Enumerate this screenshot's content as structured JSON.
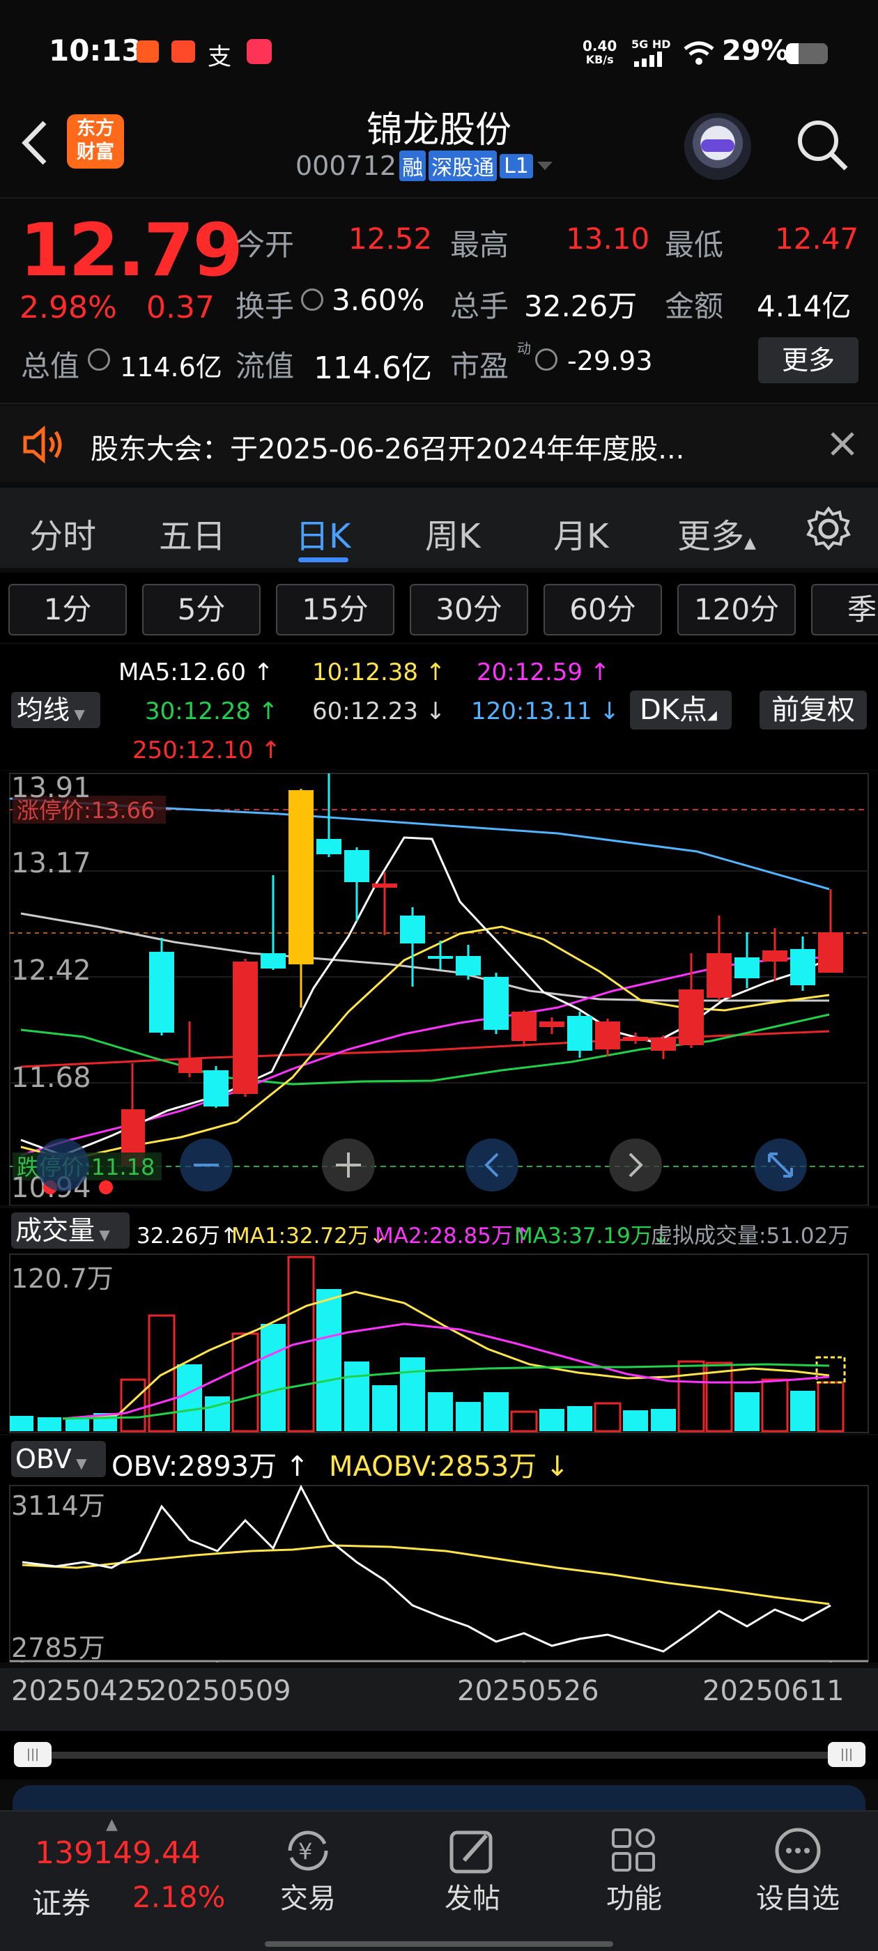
{
  "status_bar": {
    "time": "10:13",
    "net_speed_top": "0.40",
    "net_speed_bottom": "KB/s",
    "signal_label": "5G HD",
    "battery": "29%"
  },
  "header": {
    "brand_line1": "东方",
    "brand_line2": "财富",
    "title": "锦龙股份",
    "code": "000712",
    "tag_rong": "融",
    "tag_sgt": "深股通",
    "tag_l1": "L1"
  },
  "quote": {
    "price": "12.79",
    "change_pct": "2.98%",
    "change": "0.37",
    "open_label": "今开",
    "open": "12.52",
    "high_label": "最高",
    "high": "13.10",
    "low_label": "最低",
    "low": "12.47",
    "turnover_label": "换手",
    "turnover": "3.60%",
    "volume_label": "总手",
    "volume": "32.26万",
    "amount_label": "金额",
    "amount": "4.14亿",
    "mcap_label": "总值",
    "mcap": "114.6亿",
    "float_label": "流值",
    "float_value": "114.6亿",
    "pe_label": "市盈",
    "pe_sup": "动",
    "pe": "-29.93",
    "more_button": "更多"
  },
  "notice": {
    "text": "股东大会：于2025-06-26召开2024年年度股..."
  },
  "period_tabs": [
    "分时",
    "五日",
    "日K",
    "周K",
    "月K",
    "更多"
  ],
  "active_period": "日K",
  "minute_tabs": [
    "1分",
    "5分",
    "15分",
    "30分",
    "60分",
    "120分",
    "季"
  ],
  "ma_panel": {
    "selector": "均线",
    "ma5": "MA5:12.60 ↑",
    "ma10": "10:12.38 ↑",
    "ma20": "20:12.59 ↑",
    "ma30": "30:12.28 ↑",
    "ma60": "60:12.23 ↓",
    "ma120": "120:13.11 ↓",
    "ma250": "250:12.10 ↑",
    "dk_button": "DK点",
    "adjust_button": "前复权"
  },
  "kline": {
    "y_labels": [
      "13.91",
      "13.17",
      "12.42",
      "11.68",
      "10.94"
    ],
    "limit_up": "涨停价:13.66",
    "limit_down": "跌停价:11.18",
    "colors": {
      "up": "#e8262a",
      "down": "#19f3f3",
      "ma5": "#ffffff",
      "ma10": "#ffe54a",
      "ma20": "#ff33ff",
      "ma30": "#21d14a",
      "ma60": "#cccccc",
      "ma120": "#53b4ff",
      "ma250": "#e8262a"
    }
  },
  "volume_panel": {
    "selector": "成交量",
    "vol": "32.26万↑",
    "ma1": "MA1:32.72万↓",
    "ma2": "MA2:28.85万↑",
    "ma3": "MA3:37.19万↓",
    "virtual": "虚拟成交量:51.02万",
    "y_label": "120.7万"
  },
  "obv_panel": {
    "selector": "OBV",
    "obv": "OBV:2893万 ↑",
    "maobv": "MAOBV:2853万 ↓",
    "y_top": "3114万",
    "y_bottom": "2785万"
  },
  "x_axis": [
    "20250425",
    "20250509",
    "20250526",
    "20250611"
  ],
  "bottom_nav": {
    "index_value": "139149.44",
    "index_name": "证券",
    "index_change": "2.18%",
    "items": [
      "交易",
      "发帖",
      "功能",
      "设自选"
    ]
  }
}
